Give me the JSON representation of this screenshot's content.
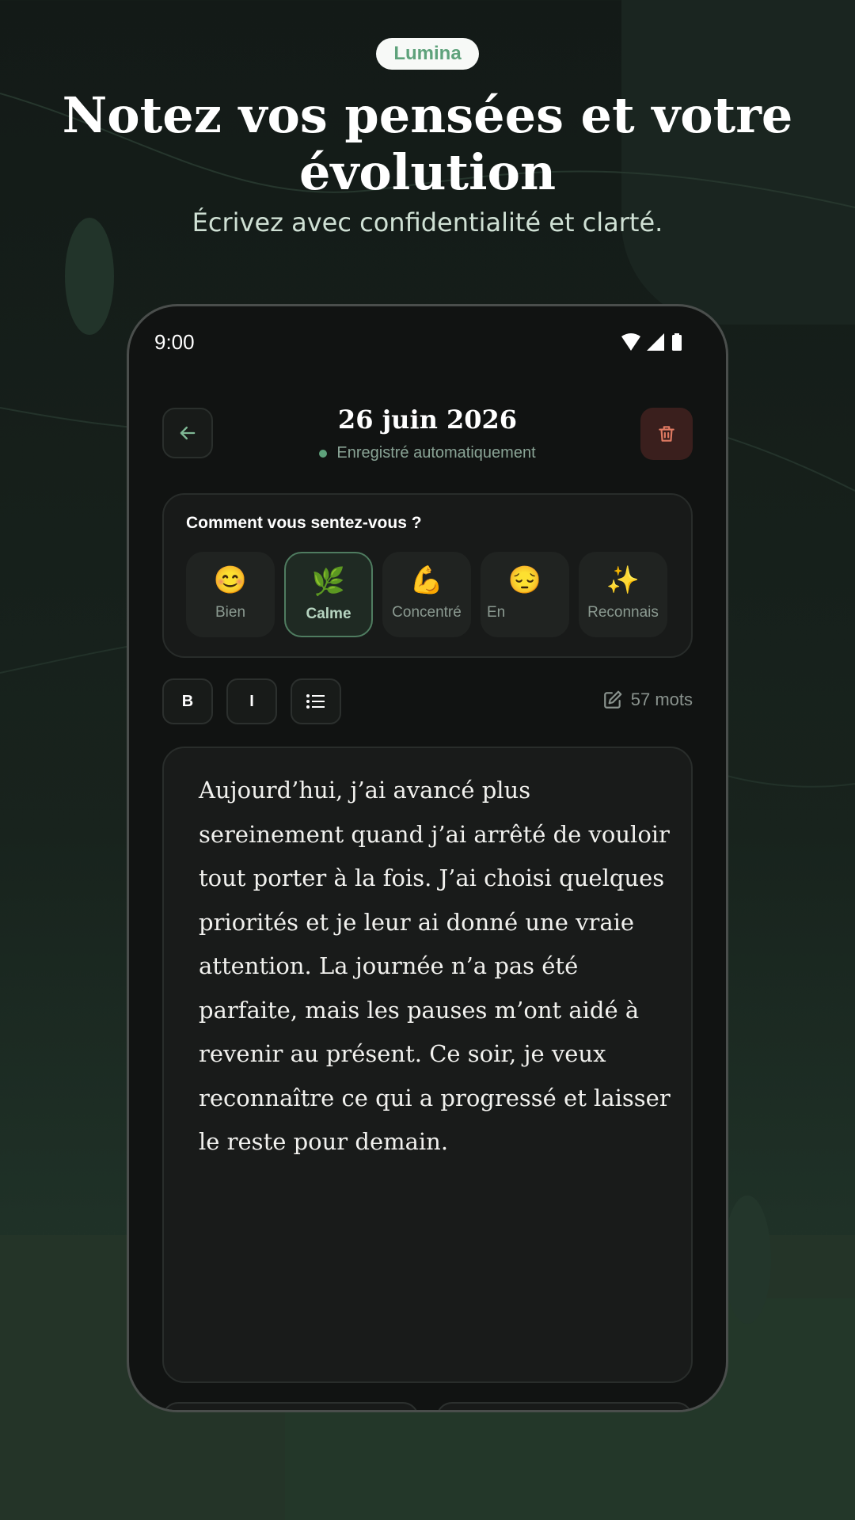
{
  "brand": "Lumina",
  "headline": "Notez vos pensées et votre évolution",
  "subline": "Écrivez avec confidentialité et clarté.",
  "status_bar": {
    "time": "9:00"
  },
  "header": {
    "date": "26 juin 2026",
    "autosave": "Enregistré automatiquement"
  },
  "mood": {
    "question": "Comment vous sentez-vous ?",
    "options": [
      {
        "emoji": "😊",
        "label": "Bien",
        "selected": false
      },
      {
        "emoji": "🌿",
        "label": "Calme",
        "selected": true
      },
      {
        "emoji": "💪",
        "label": "Concentré",
        "selected": false
      },
      {
        "emoji": "😔",
        "label": "En",
        "selected": false
      },
      {
        "emoji": "✨",
        "label": "Reconnais",
        "selected": false
      }
    ]
  },
  "toolbar": {
    "bold": "B",
    "italic": "I",
    "word_count": "57 mots"
  },
  "editor": {
    "body": "Aujourd’hui, j’ai avancé plus sereinement quand j’ai arrêté de vouloir tout porter à la fois. J’ai choisi quelques priorités et je leur ai donné une vraie attention. La journée n’a pas été parfaite, mais les pauses m’ont aidé à revenir au présent. Ce soir, je veux reconnaître ce qui a progressé et laisser le reste pour demain."
  },
  "colors": {
    "accent": "#5ea27b",
    "danger": "#e07a62",
    "background": "#131a17"
  },
  "icons": [
    "arrow-left-icon",
    "trash-icon",
    "list-icon",
    "edit-icon",
    "wifi-icon",
    "signal-icon",
    "battery-icon"
  ]
}
